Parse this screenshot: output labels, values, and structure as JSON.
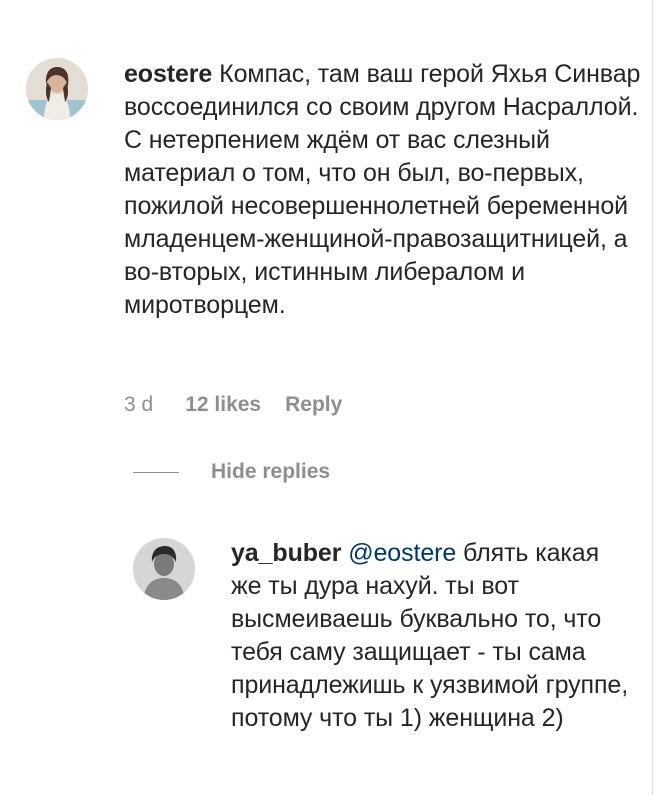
{
  "comment": {
    "username": "eostere",
    "text": "Компас, там ваш герой Яхья Синвар воссоединился со своим другом Насраллой. С нетерпением ждём от вас слезный материал о том, что он был, во-первых, пожилой несовершеннолетней беременной младенцем-женщиной-правозащитницей, а во-вторых, истинным либералом и миротворцем.",
    "time": "3 d",
    "likes": "12 likes",
    "reply_label": "Reply"
  },
  "hide_replies_label": "Hide replies",
  "reply": {
    "username": "ya_buber",
    "mention": "@eostere",
    "text": "блять какая же ты дура нахуй. ты вот высмеиваешь буквально то, что тебя саму защищает - ты сама принадлежишь к уязвимой группе, потому что ты 1) женщина 2)"
  },
  "colors": {
    "text": "#262626",
    "secondary": "#8e8e8e",
    "mention": "#00376b"
  }
}
